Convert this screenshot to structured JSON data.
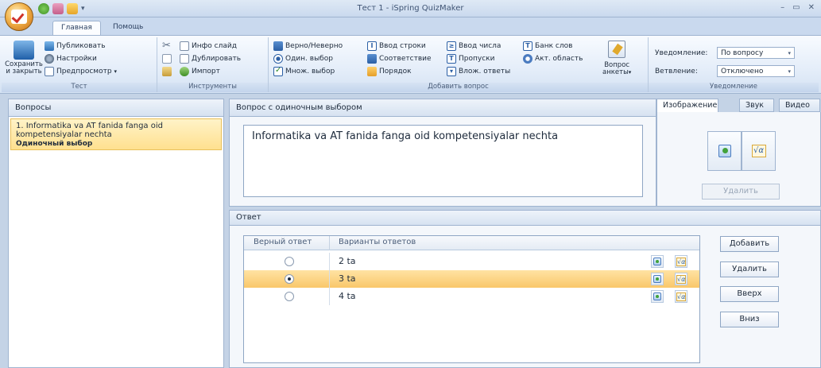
{
  "window": {
    "title": "Тест 1 - iSpring QuizMaker",
    "controls": [
      "–",
      "▭",
      "✕"
    ]
  },
  "quick_access": {
    "more": "▾"
  },
  "tabs": [
    {
      "label": "Главная",
      "active": true
    },
    {
      "label": "Помощь",
      "active": false
    }
  ],
  "ribbon": {
    "test": {
      "label": "Тест",
      "save_close_line1": "Сохранить",
      "save_close_line2": "и закрыть",
      "publish": "Публиковать",
      "settings": "Настройки",
      "preview": "Предпросмотр",
      "preview_arrow": "▾"
    },
    "tools": {
      "label": "Инструменты",
      "info_slide": "Инфо слайд",
      "duplicate": "Дублировать",
      "import": "Импорт"
    },
    "add_question": {
      "label": "Добавить вопрос",
      "true_false": "Верно/Неверно",
      "single_choice": "Один. выбор",
      "multiple_choice": "Множ. выбор",
      "type_in": "Ввод строки",
      "matching": "Соответствие",
      "sequence": "Порядок",
      "numeric": "Ввод числа",
      "fill_blanks": "Пропуски",
      "multiple_responses": "Влож. ответы",
      "word_bank": "Банк слов",
      "hotspot": "Акт. область",
      "survey_line1": "Вопрос",
      "survey_line2": "анкеты",
      "survey_arrow": "▾"
    },
    "notification": {
      "label": "Уведомление",
      "notify_label": "Уведомление:",
      "notify_value": "По вопросу",
      "branch_label": "Ветвление:",
      "branch_value": "Отключено"
    }
  },
  "questions_panel": {
    "header": "Вопросы",
    "items": [
      {
        "number": "1.",
        "title": "Informatika va AT fanida fanga oid kompetensiyalar nechta",
        "type": "Одиночный выбор"
      }
    ]
  },
  "question_panel": {
    "header": "Вопрос с одиночным выбором",
    "text": "Informatika va AT fanida fanga oid kompetensiyalar nechta"
  },
  "media_panel": {
    "tabs": [
      {
        "label": "Изображение",
        "active": true
      },
      {
        "label": "Звук",
        "active": false
      },
      {
        "label": "Видео",
        "active": false
      }
    ],
    "formula_symbol": "√α",
    "delete_button": "Удалить"
  },
  "answer_panel": {
    "header": "Ответ",
    "columns": [
      "Верный ответ",
      "Варианты ответов"
    ],
    "rows": [
      {
        "correct": false,
        "text": "2 ta"
      },
      {
        "correct": true,
        "text": "3 ta"
      },
      {
        "correct": false,
        "text": "4 ta"
      }
    ],
    "buttons": {
      "add": "Добавить",
      "delete": "Удалить",
      "up": "Вверх",
      "down": "Вниз"
    }
  }
}
